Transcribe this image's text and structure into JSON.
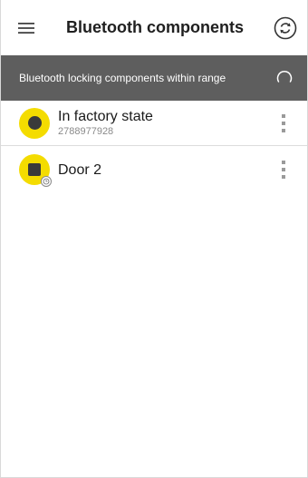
{
  "appbar": {
    "title": "Bluetooth components",
    "menu_icon": "hamburger-menu-icon",
    "sync_icon": "sync-icon"
  },
  "banner": {
    "text": "Bluetooth locking components within range",
    "spinner_icon": "loading-spinner-icon"
  },
  "items": [
    {
      "title": "In factory state",
      "subtitle": "2788977928",
      "icon": "round-lock-icon"
    },
    {
      "title": "Door 2",
      "subtitle": "",
      "icon": "square-lock-icon"
    }
  ],
  "colors": {
    "accent": "#f4dc00",
    "banner": "#5e5e5e",
    "icon_dark": "#3a3a3a"
  }
}
